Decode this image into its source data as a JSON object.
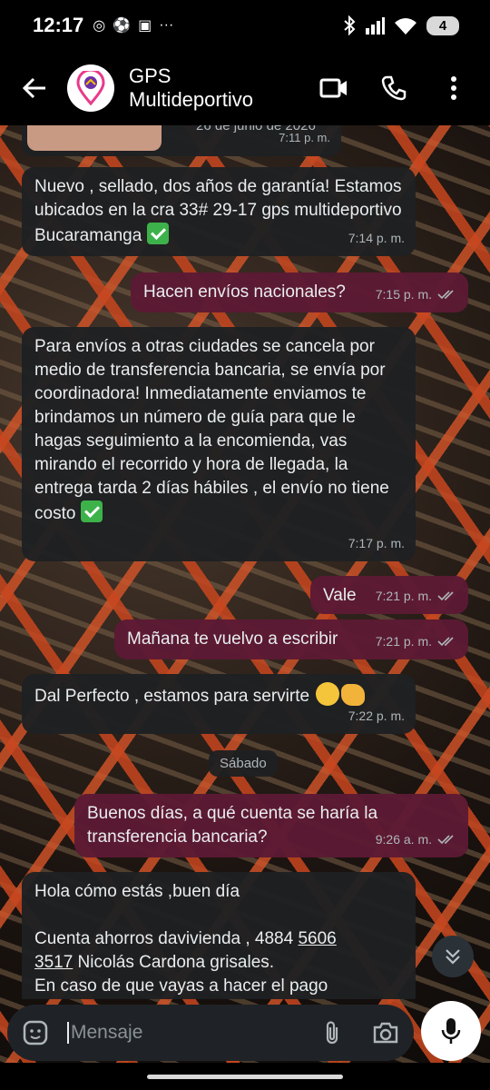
{
  "status_bar": {
    "time": "12:17",
    "battery": "4"
  },
  "header": {
    "contact_name": "GPS Multideportivo"
  },
  "chat": {
    "photo_caption": "26 de junio de 2026",
    "photo_time": "7:11 p. m.",
    "messages": [
      {
        "dir": "in",
        "text": "Nuevo , sellado, dos años de garantía! Estamos ubicados en la cra 33# 29-17 gps multideportivo Bucaramanga",
        "time": "7:14 p. m."
      },
      {
        "dir": "out",
        "text": "Hacen envíos nacionales?",
        "time": "7:15 p. m."
      },
      {
        "dir": "in",
        "text": "Para envíos a otras ciudades se cancela por medio de transferencia bancaria, se envía por coordinadora! Inmediatamente enviamos te brindamos un número de guía para que le hagas seguimiento a la encomienda, vas mirando el recorrido y hora de llegada, la entrega tarda 2 días hábiles , el envío no tiene costo",
        "time": "7:17 p. m."
      },
      {
        "dir": "out",
        "text": "Vale",
        "time": "7:21 p. m."
      },
      {
        "dir": "out",
        "text": "Mañana te vuelvo a escribir",
        "time": "7:21 p. m."
      },
      {
        "dir": "in",
        "text": "Dal Perfecto , estamos para servirte",
        "time": "7:22 p. m."
      },
      {
        "dir": "out",
        "text": "Buenos días, a qué cuenta se haría la transferencia bancaria?",
        "time": "9:26 a. m."
      }
    ],
    "date_separator": "Sábado",
    "last_message": {
      "line1": "Hola cómo estás ,buen día",
      "line2_a": "Cuenta ahorros davivienda , 4884 ",
      "line2_link": "5606",
      "line3_link": "3517",
      "line3_b": " Nicolás Cardona grisales.",
      "line4": "En caso de que vayas a hacer el pago"
    }
  },
  "input": {
    "placeholder": "Mensaje"
  }
}
